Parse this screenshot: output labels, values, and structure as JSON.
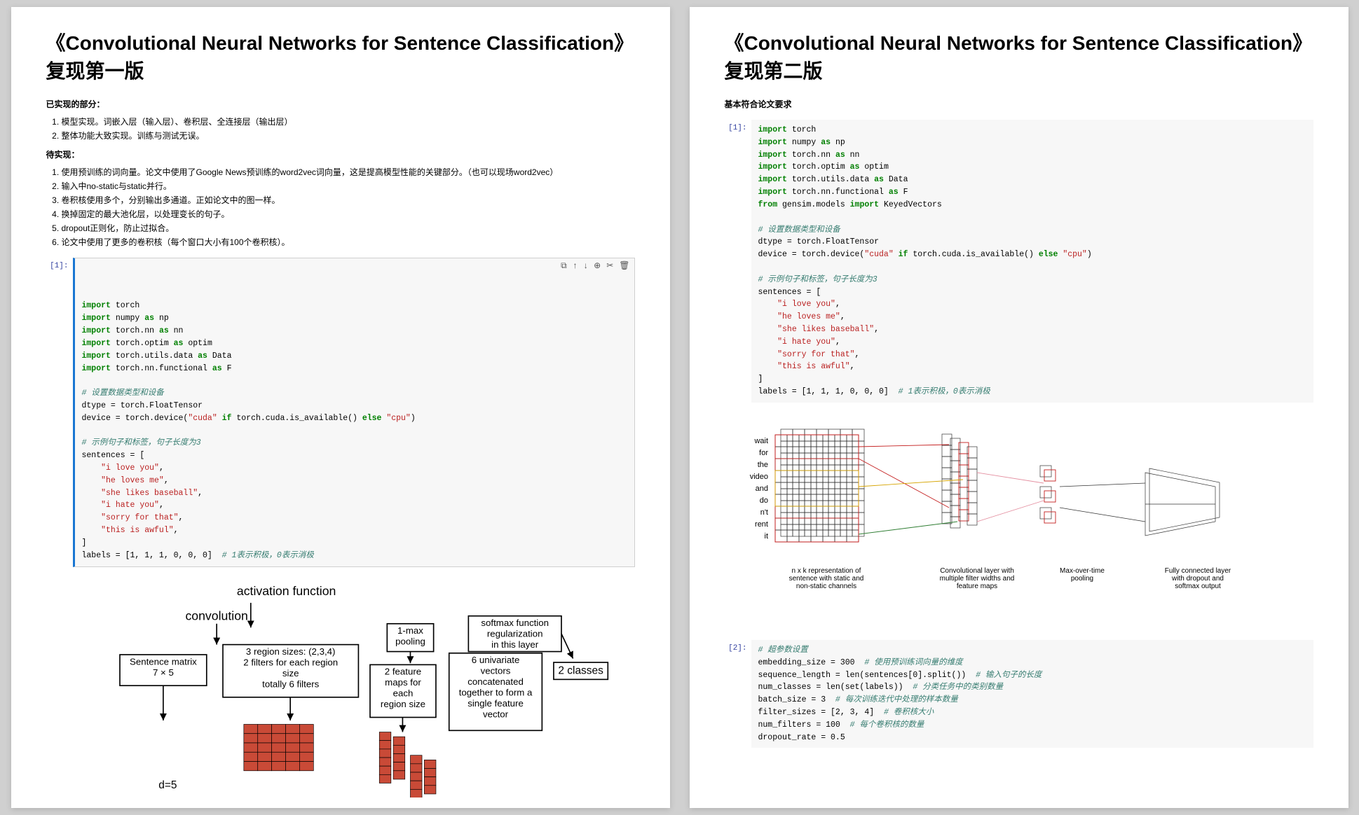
{
  "left": {
    "title": "《Convolutional Neural Networks for Sentence Classification》复现第一版",
    "section1_header": "已实现的部分：",
    "implemented": [
      "模型实现。词嵌入层（输入层）、卷积层、全连接层（输出层）",
      "整体功能大致实现。训练与测试无误。"
    ],
    "section2_header": "待实现：",
    "todo": [
      "使用预训练的词向量。论文中使用了Google News预训练的word2vec词向量，这是提高模型性能的关键部分。（也可以现场word2vec）",
      "输入中no-static与static并行。",
      "卷积核使用多个，分别输出多通道。正如论文中的图一样。",
      "换掉固定的最大池化层，以处理变长的句子。",
      "dropout正则化，防止过拟合。",
      "论文中使用了更多的卷积核（每个窗口大小有100个卷积核）。"
    ],
    "prompt1": "[1]:",
    "toolbar_icons": {
      "copy": "⧉",
      "up": "↑",
      "down": "↓",
      "add": "⊕",
      "cut": "✂",
      "del": "🗑"
    },
    "code1": [
      {
        "t": "kw",
        "v": "import"
      },
      {
        "t": "nm",
        "v": " torch"
      },
      {
        "t": "nl"
      },
      {
        "t": "kw",
        "v": "import"
      },
      {
        "t": "nm",
        "v": " numpy "
      },
      {
        "t": "kw",
        "v": "as"
      },
      {
        "t": "nm",
        "v": " np"
      },
      {
        "t": "nl"
      },
      {
        "t": "kw",
        "v": "import"
      },
      {
        "t": "nm",
        "v": " torch.nn "
      },
      {
        "t": "kw",
        "v": "as"
      },
      {
        "t": "nm",
        "v": " nn"
      },
      {
        "t": "nl"
      },
      {
        "t": "kw",
        "v": "import"
      },
      {
        "t": "nm",
        "v": " torch.optim "
      },
      {
        "t": "kw",
        "v": "as"
      },
      {
        "t": "nm",
        "v": " optim"
      },
      {
        "t": "nl"
      },
      {
        "t": "kw",
        "v": "import"
      },
      {
        "t": "nm",
        "v": " torch.utils.data "
      },
      {
        "t": "kw",
        "v": "as"
      },
      {
        "t": "nm",
        "v": " Data"
      },
      {
        "t": "nl"
      },
      {
        "t": "kw",
        "v": "import"
      },
      {
        "t": "nm",
        "v": " torch.nn.functional "
      },
      {
        "t": "kw",
        "v": "as"
      },
      {
        "t": "nm",
        "v": " F"
      },
      {
        "t": "nl"
      },
      {
        "t": "nl"
      },
      {
        "t": "cmt",
        "v": "# 设置数据类型和设备"
      },
      {
        "t": "nl"
      },
      {
        "t": "nm",
        "v": "dtype = torch.FloatTensor"
      },
      {
        "t": "nl"
      },
      {
        "t": "nm",
        "v": "device = torch.device("
      },
      {
        "t": "str",
        "v": "\"cuda\""
      },
      {
        "t": "nm",
        "v": " "
      },
      {
        "t": "kw",
        "v": "if"
      },
      {
        "t": "nm",
        "v": " torch.cuda.is_available() "
      },
      {
        "t": "kw",
        "v": "else"
      },
      {
        "t": "nm",
        "v": " "
      },
      {
        "t": "str",
        "v": "\"cpu\""
      },
      {
        "t": "nm",
        "v": ")"
      },
      {
        "t": "nl"
      },
      {
        "t": "nl"
      },
      {
        "t": "cmt",
        "v": "# 示例句子和标签，句子长度为3"
      },
      {
        "t": "nl"
      },
      {
        "t": "nm",
        "v": "sentences = ["
      },
      {
        "t": "nl"
      },
      {
        "t": "nm",
        "v": "    "
      },
      {
        "t": "str",
        "v": "\"i love you\""
      },
      {
        "t": "nm",
        "v": ","
      },
      {
        "t": "nl"
      },
      {
        "t": "nm",
        "v": "    "
      },
      {
        "t": "str",
        "v": "\"he loves me\""
      },
      {
        "t": "nm",
        "v": ","
      },
      {
        "t": "nl"
      },
      {
        "t": "nm",
        "v": "    "
      },
      {
        "t": "str",
        "v": "\"she likes baseball\""
      },
      {
        "t": "nm",
        "v": ","
      },
      {
        "t": "nl"
      },
      {
        "t": "nm",
        "v": "    "
      },
      {
        "t": "str",
        "v": "\"i hate you\""
      },
      {
        "t": "nm",
        "v": ","
      },
      {
        "t": "nl"
      },
      {
        "t": "nm",
        "v": "    "
      },
      {
        "t": "str",
        "v": "\"sorry for that\""
      },
      {
        "t": "nm",
        "v": ","
      },
      {
        "t": "nl"
      },
      {
        "t": "nm",
        "v": "    "
      },
      {
        "t": "str",
        "v": "\"this is awful\""
      },
      {
        "t": "nm",
        "v": ","
      },
      {
        "t": "nl"
      },
      {
        "t": "nm",
        "v": "]"
      },
      {
        "t": "nl"
      },
      {
        "t": "nm",
        "v": "labels = [1, 1, 1, 0, 0, 0]  "
      },
      {
        "t": "cmt",
        "v": "# 1表示积极，0表示消极"
      }
    ],
    "diagram": {
      "heading_activation": "activation function",
      "heading_convolution": "convolution",
      "box_sentence": "Sentence matrix\n7 × 5",
      "box_filters": "3 region sizes: (2,3,4)\n2 filters for each region\nsize\ntotally 6 filters",
      "box_pooling": "1-max\npooling",
      "box_featmaps": "2 feature\nmaps for\neach\nregion size",
      "box_univariate": "6 univariate\nvectors\nconcatenated\ntogether to form a\nsingle feature\nvector",
      "box_softmax": "softmax function\nregularization\nin this layer",
      "box_classes": "2 classes",
      "d5": "d=5"
    }
  },
  "right": {
    "title": "《Convolutional Neural Networks for Sentence Classification》复现第二版",
    "subtitle": "基本符合论文要求",
    "prompt1": "[1]:",
    "code1": [
      {
        "t": "kw",
        "v": "import"
      },
      {
        "t": "nm",
        "v": " torch"
      },
      {
        "t": "nl"
      },
      {
        "t": "kw",
        "v": "import"
      },
      {
        "t": "nm",
        "v": " numpy "
      },
      {
        "t": "kw",
        "v": "as"
      },
      {
        "t": "nm",
        "v": " np"
      },
      {
        "t": "nl"
      },
      {
        "t": "kw",
        "v": "import"
      },
      {
        "t": "nm",
        "v": " torch.nn "
      },
      {
        "t": "kw",
        "v": "as"
      },
      {
        "t": "nm",
        "v": " nn"
      },
      {
        "t": "nl"
      },
      {
        "t": "kw",
        "v": "import"
      },
      {
        "t": "nm",
        "v": " torch.optim "
      },
      {
        "t": "kw",
        "v": "as"
      },
      {
        "t": "nm",
        "v": " optim"
      },
      {
        "t": "nl"
      },
      {
        "t": "kw",
        "v": "import"
      },
      {
        "t": "nm",
        "v": " torch.utils.data "
      },
      {
        "t": "kw",
        "v": "as"
      },
      {
        "t": "nm",
        "v": " Data"
      },
      {
        "t": "nl"
      },
      {
        "t": "kw",
        "v": "import"
      },
      {
        "t": "nm",
        "v": " torch.nn.functional "
      },
      {
        "t": "kw",
        "v": "as"
      },
      {
        "t": "nm",
        "v": " F"
      },
      {
        "t": "nl"
      },
      {
        "t": "kw",
        "v": "from"
      },
      {
        "t": "nm",
        "v": " gensim.models "
      },
      {
        "t": "kw",
        "v": "import"
      },
      {
        "t": "nm",
        "v": " KeyedVectors"
      },
      {
        "t": "nl"
      },
      {
        "t": "nl"
      },
      {
        "t": "cmt",
        "v": "# 设置数据类型和设备"
      },
      {
        "t": "nl"
      },
      {
        "t": "nm",
        "v": "dtype = torch.FloatTensor"
      },
      {
        "t": "nl"
      },
      {
        "t": "nm",
        "v": "device = torch.device("
      },
      {
        "t": "str",
        "v": "\"cuda\""
      },
      {
        "t": "nm",
        "v": " "
      },
      {
        "t": "kw",
        "v": "if"
      },
      {
        "t": "nm",
        "v": " torch.cuda.is_available() "
      },
      {
        "t": "kw",
        "v": "else"
      },
      {
        "t": "nm",
        "v": " "
      },
      {
        "t": "str",
        "v": "\"cpu\""
      },
      {
        "t": "nm",
        "v": ")"
      },
      {
        "t": "nl"
      },
      {
        "t": "nl"
      },
      {
        "t": "cmt",
        "v": "# 示例句子和标签，句子长度为3"
      },
      {
        "t": "nl"
      },
      {
        "t": "nm",
        "v": "sentences = ["
      },
      {
        "t": "nl"
      },
      {
        "t": "nm",
        "v": "    "
      },
      {
        "t": "str",
        "v": "\"i love you\""
      },
      {
        "t": "nm",
        "v": ","
      },
      {
        "t": "nl"
      },
      {
        "t": "nm",
        "v": "    "
      },
      {
        "t": "str",
        "v": "\"he loves me\""
      },
      {
        "t": "nm",
        "v": ","
      },
      {
        "t": "nl"
      },
      {
        "t": "nm",
        "v": "    "
      },
      {
        "t": "str",
        "v": "\"she likes baseball\""
      },
      {
        "t": "nm",
        "v": ","
      },
      {
        "t": "nl"
      },
      {
        "t": "nm",
        "v": "    "
      },
      {
        "t": "str",
        "v": "\"i hate you\""
      },
      {
        "t": "nm",
        "v": ","
      },
      {
        "t": "nl"
      },
      {
        "t": "nm",
        "v": "    "
      },
      {
        "t": "str",
        "v": "\"sorry for that\""
      },
      {
        "t": "nm",
        "v": ","
      },
      {
        "t": "nl"
      },
      {
        "t": "nm",
        "v": "    "
      },
      {
        "t": "str",
        "v": "\"this is awful\""
      },
      {
        "t": "nm",
        "v": ","
      },
      {
        "t": "nl"
      },
      {
        "t": "nm",
        "v": "]"
      },
      {
        "t": "nl"
      },
      {
        "t": "nm",
        "v": "labels = [1, 1, 1, 0, 0, 0]  "
      },
      {
        "t": "cmt",
        "v": "# 1表示积极，0表示消极"
      }
    ],
    "diagram": {
      "words": [
        "wait",
        "for",
        "the",
        "video",
        "and",
        "do",
        "n't",
        "rent",
        "it"
      ],
      "caption1": "n x k representation of\nsentence with static and\nnon-static channels",
      "caption2": "Convolutional layer with\nmultiple filter widths and\nfeature maps",
      "caption3": "Max-over-time\npooling",
      "caption4": "Fully connected layer\nwith dropout and\nsoftmax output"
    },
    "prompt2": "[2]:",
    "code2": [
      {
        "t": "cmt",
        "v": "# 超参数设置"
      },
      {
        "t": "nl"
      },
      {
        "t": "nm",
        "v": "embedding_size = 300  "
      },
      {
        "t": "cmt",
        "v": "# 使用预训练词向量的维度"
      },
      {
        "t": "nl"
      },
      {
        "t": "nm",
        "v": "sequence_length = len(sentences[0].split())  "
      },
      {
        "t": "cmt",
        "v": "# 输入句子的长度"
      },
      {
        "t": "nl"
      },
      {
        "t": "nm",
        "v": "num_classes = len(set(labels))  "
      },
      {
        "t": "cmt",
        "v": "# 分类任务中的类别数量"
      },
      {
        "t": "nl"
      },
      {
        "t": "nm",
        "v": "batch_size = 3  "
      },
      {
        "t": "cmt",
        "v": "# 每次训练迭代中处理的样本数量"
      },
      {
        "t": "nl"
      },
      {
        "t": "nm",
        "v": "filter_sizes = [2, 3, 4]  "
      },
      {
        "t": "cmt",
        "v": "# 卷积核大小"
      },
      {
        "t": "nl"
      },
      {
        "t": "nm",
        "v": "num_filters = 100  "
      },
      {
        "t": "cmt",
        "v": "# 每个卷积核的数量"
      },
      {
        "t": "nl"
      },
      {
        "t": "nm",
        "v": "dropout_rate = 0.5"
      }
    ]
  }
}
